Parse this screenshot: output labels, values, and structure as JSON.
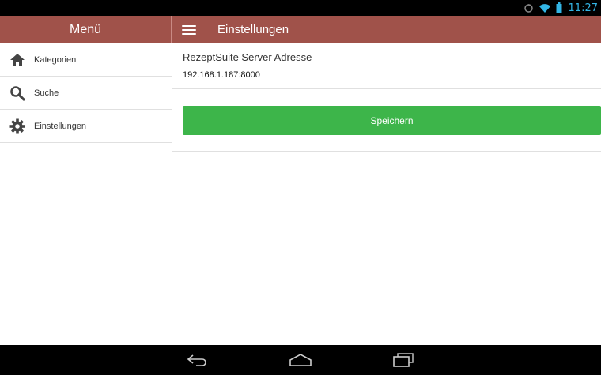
{
  "status_bar": {
    "time": "11:27",
    "icons": [
      "sync-icon",
      "wifi-icon",
      "battery-icon"
    ],
    "accent_color": "#33b5e5"
  },
  "sidebar": {
    "title": "Menü",
    "items": [
      {
        "label": "Kategorien",
        "icon": "home-icon"
      },
      {
        "label": "Suche",
        "icon": "search-icon"
      },
      {
        "label": "Einstellungen",
        "icon": "gear-icon"
      }
    ]
  },
  "main": {
    "title": "Einstellungen",
    "server_field": {
      "label": "RezeptSuite Server Adresse",
      "value": "192.168.1.187:8000"
    },
    "save_label": "Speichern"
  },
  "colors": {
    "header": "#a0524a",
    "button": "#3db54a",
    "background": "#ffffff"
  },
  "nav_bar": {
    "buttons": [
      "back-icon",
      "home-icon",
      "recent-apps-icon"
    ]
  }
}
